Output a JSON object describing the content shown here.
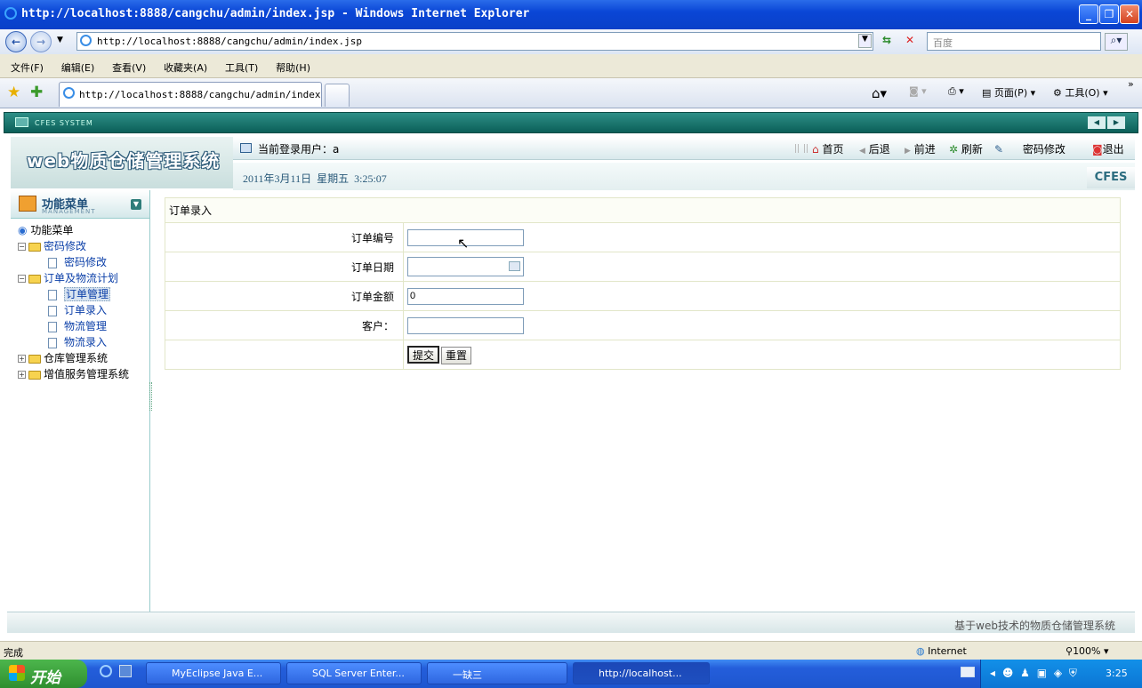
{
  "window": {
    "title": "http://localhost:8888/cangchu/admin/index.jsp - Windows Internet Explorer"
  },
  "browser": {
    "address": "http://localhost:8888/cangchu/admin/index.jsp",
    "search_placeholder": "百度",
    "menu": [
      "文件(F)",
      "编辑(E)",
      "查看(V)",
      "收藏夹(A)",
      "工具(T)",
      "帮助(H)"
    ],
    "tab_title": "http://localhost:8888/cangchu/admin/index...",
    "page_label": "页面(P)",
    "tools_label": "工具(O)",
    "status": "完成",
    "zone": "Internet",
    "zoom": "100%"
  },
  "app": {
    "frame_label": "CFES SYSTEM",
    "logo_text": "web物质仓储管理系统",
    "current_user": "当前登录用户：a",
    "date_time": "2011年3月11日  星期五  3:25:07",
    "brand": "CFES",
    "nav": {
      "home": "首页",
      "back": "后退",
      "forward": "前进",
      "refresh": "刷新",
      "change_password": "密码修改",
      "logout": "退出"
    },
    "footer": "基于web技术的物质仓储管理系统"
  },
  "sidebar": {
    "title": "功能菜单",
    "subtitle": "MANAGEMENT",
    "root": "功能菜单",
    "groups": [
      {
        "label": "密码修改",
        "items": [
          "密码修改"
        ]
      },
      {
        "label": "订单及物流计划",
        "items": [
          "订单管理",
          "订单录入",
          "物流管理",
          "物流录入"
        ]
      },
      {
        "label": "仓库管理系统",
        "items": []
      },
      {
        "label": "增值服务管理系统",
        "items": []
      }
    ]
  },
  "form": {
    "title": "订单录入",
    "fields": {
      "order_no_label": "订单编号",
      "order_no_value": "",
      "order_date_label": "订单日期",
      "order_date_value": "",
      "amount_label": "订单金额",
      "amount_value": "0",
      "customer_label": "客户：",
      "customer_value": ""
    },
    "submit": "提交",
    "reset": "重置"
  },
  "taskbar": {
    "start": "开始",
    "tasks": [
      "MyEclipse Java E...",
      "SQL Server Enter...",
      "一缺三",
      "http://localhost..."
    ],
    "clock": "3:25"
  }
}
